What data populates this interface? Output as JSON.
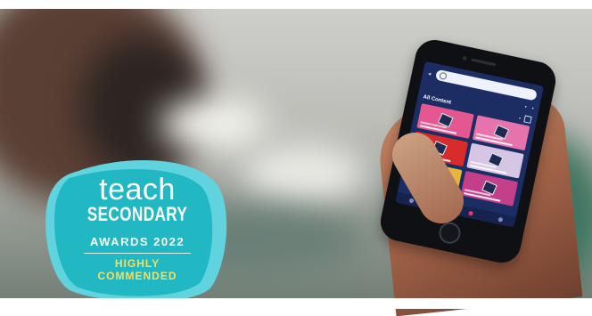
{
  "badge": {
    "line1": "teach",
    "line2": "SECONDARY",
    "line3": "AWARDS 2022",
    "line4": "HIGHLY",
    "line5": "COMMENDED",
    "colors": {
      "primary": "#21b8c4",
      "shape_back": "#61d3df",
      "text": "#ffffff",
      "highlight": "#f2e066"
    }
  },
  "phone_app": {
    "section_title": "All Content",
    "colors": {
      "background": "#1c2d63",
      "nav_active": "#ff2c6a"
    },
    "cards": [
      {
        "color": "#e4588f"
      },
      {
        "color": "#e773ac"
      },
      {
        "color": "#d82b2b"
      },
      {
        "color": "#d6c6e6"
      },
      {
        "color": "#e5b53c"
      },
      {
        "color": "#c43f8a"
      }
    ]
  }
}
